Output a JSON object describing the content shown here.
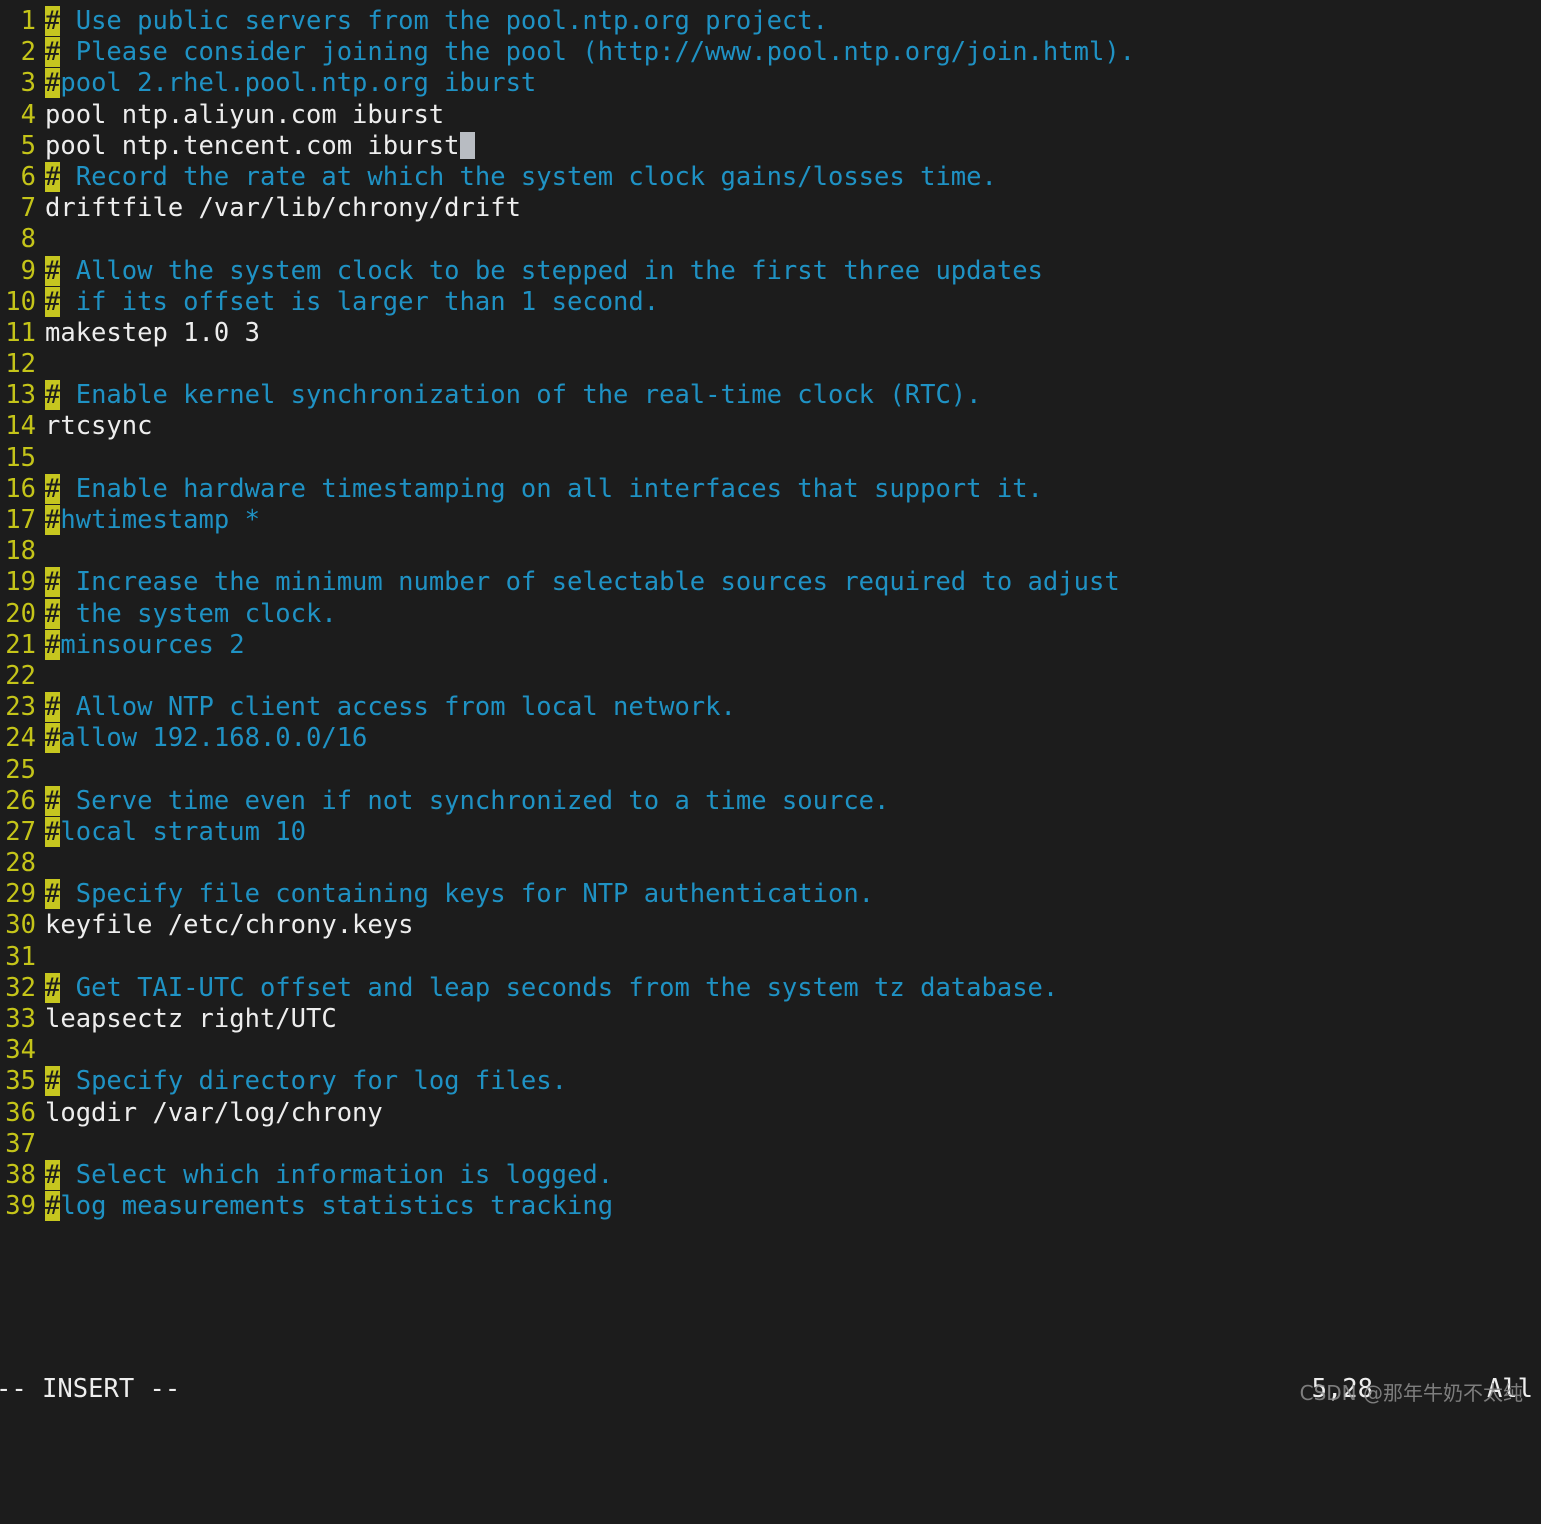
{
  "terminal": {
    "app": "vim",
    "file": "chrony.conf",
    "background": "#1c1c1c",
    "foreground": "#e8e8e8",
    "comment_color": "#1f92c4",
    "linenumber_color": "#c4c419",
    "hash_highlight_color": "#c6c61f",
    "cursor_color": "#b8bcc2"
  },
  "buffer": {
    "lines": [
      {
        "n": "1",
        "hash": "#",
        "text": " Use public servers from the pool.ntp.org project.",
        "kind": "comment"
      },
      {
        "n": "2",
        "hash": "#",
        "text": " Please consider joining the pool (http://www.pool.ntp.org/join.html).",
        "kind": "comment"
      },
      {
        "n": "3",
        "hash": "#",
        "text": "pool 2.rhel.pool.ntp.org iburst",
        "kind": "comment"
      },
      {
        "n": "4",
        "hash": "",
        "text": "pool ntp.aliyun.com iburst",
        "kind": "plain"
      },
      {
        "n": "5",
        "hash": "",
        "text": "pool ntp.tencent.com iburst",
        "kind": "plain",
        "cursor": true
      },
      {
        "n": "6",
        "hash": "#",
        "text": " Record the rate at which the system clock gains/losses time.",
        "kind": "comment"
      },
      {
        "n": "7",
        "hash": "",
        "text": "driftfile /var/lib/chrony/drift",
        "kind": "plain"
      },
      {
        "n": "8",
        "hash": "",
        "text": "",
        "kind": "empty"
      },
      {
        "n": "9",
        "hash": "#",
        "text": " Allow the system clock to be stepped in the first three updates",
        "kind": "comment"
      },
      {
        "n": "10",
        "hash": "#",
        "text": " if its offset is larger than 1 second.",
        "kind": "comment"
      },
      {
        "n": "11",
        "hash": "",
        "text": "makestep 1.0 3",
        "kind": "plain"
      },
      {
        "n": "12",
        "hash": "",
        "text": "",
        "kind": "empty"
      },
      {
        "n": "13",
        "hash": "#",
        "text": " Enable kernel synchronization of the real-time clock (RTC).",
        "kind": "comment"
      },
      {
        "n": "14",
        "hash": "",
        "text": "rtcsync",
        "kind": "plain"
      },
      {
        "n": "15",
        "hash": "",
        "text": "",
        "kind": "empty"
      },
      {
        "n": "16",
        "hash": "#",
        "text": " Enable hardware timestamping on all interfaces that support it.",
        "kind": "comment"
      },
      {
        "n": "17",
        "hash": "#",
        "text": "hwtimestamp *",
        "kind": "comment"
      },
      {
        "n": "18",
        "hash": "",
        "text": "",
        "kind": "empty"
      },
      {
        "n": "19",
        "hash": "#",
        "text": " Increase the minimum number of selectable sources required to adjust",
        "kind": "comment"
      },
      {
        "n": "20",
        "hash": "#",
        "text": " the system clock.",
        "kind": "comment"
      },
      {
        "n": "21",
        "hash": "#",
        "text": "minsources 2",
        "kind": "comment"
      },
      {
        "n": "22",
        "hash": "",
        "text": "",
        "kind": "empty"
      },
      {
        "n": "23",
        "hash": "#",
        "text": " Allow NTP client access from local network.",
        "kind": "comment"
      },
      {
        "n": "24",
        "hash": "#",
        "text": "allow 192.168.0.0/16",
        "kind": "comment"
      },
      {
        "n": "25",
        "hash": "",
        "text": "",
        "kind": "empty"
      },
      {
        "n": "26",
        "hash": "#",
        "text": " Serve time even if not synchronized to a time source.",
        "kind": "comment"
      },
      {
        "n": "27",
        "hash": "#",
        "text": "local stratum 10",
        "kind": "comment"
      },
      {
        "n": "28",
        "hash": "",
        "text": "",
        "kind": "empty"
      },
      {
        "n": "29",
        "hash": "#",
        "text": " Specify file containing keys for NTP authentication.",
        "kind": "comment"
      },
      {
        "n": "30",
        "hash": "",
        "text": "keyfile /etc/chrony.keys",
        "kind": "plain"
      },
      {
        "n": "31",
        "hash": "",
        "text": "",
        "kind": "empty"
      },
      {
        "n": "32",
        "hash": "#",
        "text": " Get TAI-UTC offset and leap seconds from the system tz database.",
        "kind": "comment"
      },
      {
        "n": "33",
        "hash": "",
        "text": "leapsectz right/UTC",
        "kind": "plain"
      },
      {
        "n": "34",
        "hash": "",
        "text": "",
        "kind": "empty"
      },
      {
        "n": "35",
        "hash": "#",
        "text": " Specify directory for log files.",
        "kind": "comment"
      },
      {
        "n": "36",
        "hash": "",
        "text": "logdir /var/log/chrony",
        "kind": "plain"
      },
      {
        "n": "37",
        "hash": "",
        "text": "",
        "kind": "empty"
      },
      {
        "n": "38",
        "hash": "#",
        "text": " Select which information is logged.",
        "kind": "comment"
      },
      {
        "n": "39",
        "hash": "#",
        "text": "log measurements statistics tracking",
        "kind": "comment"
      }
    ]
  },
  "statusline": {
    "mode": "-- INSERT --",
    "ruler": "5,28",
    "scroll_position": "All"
  },
  "watermark": {
    "text": "CSDN @那年牛奶不太纯"
  }
}
